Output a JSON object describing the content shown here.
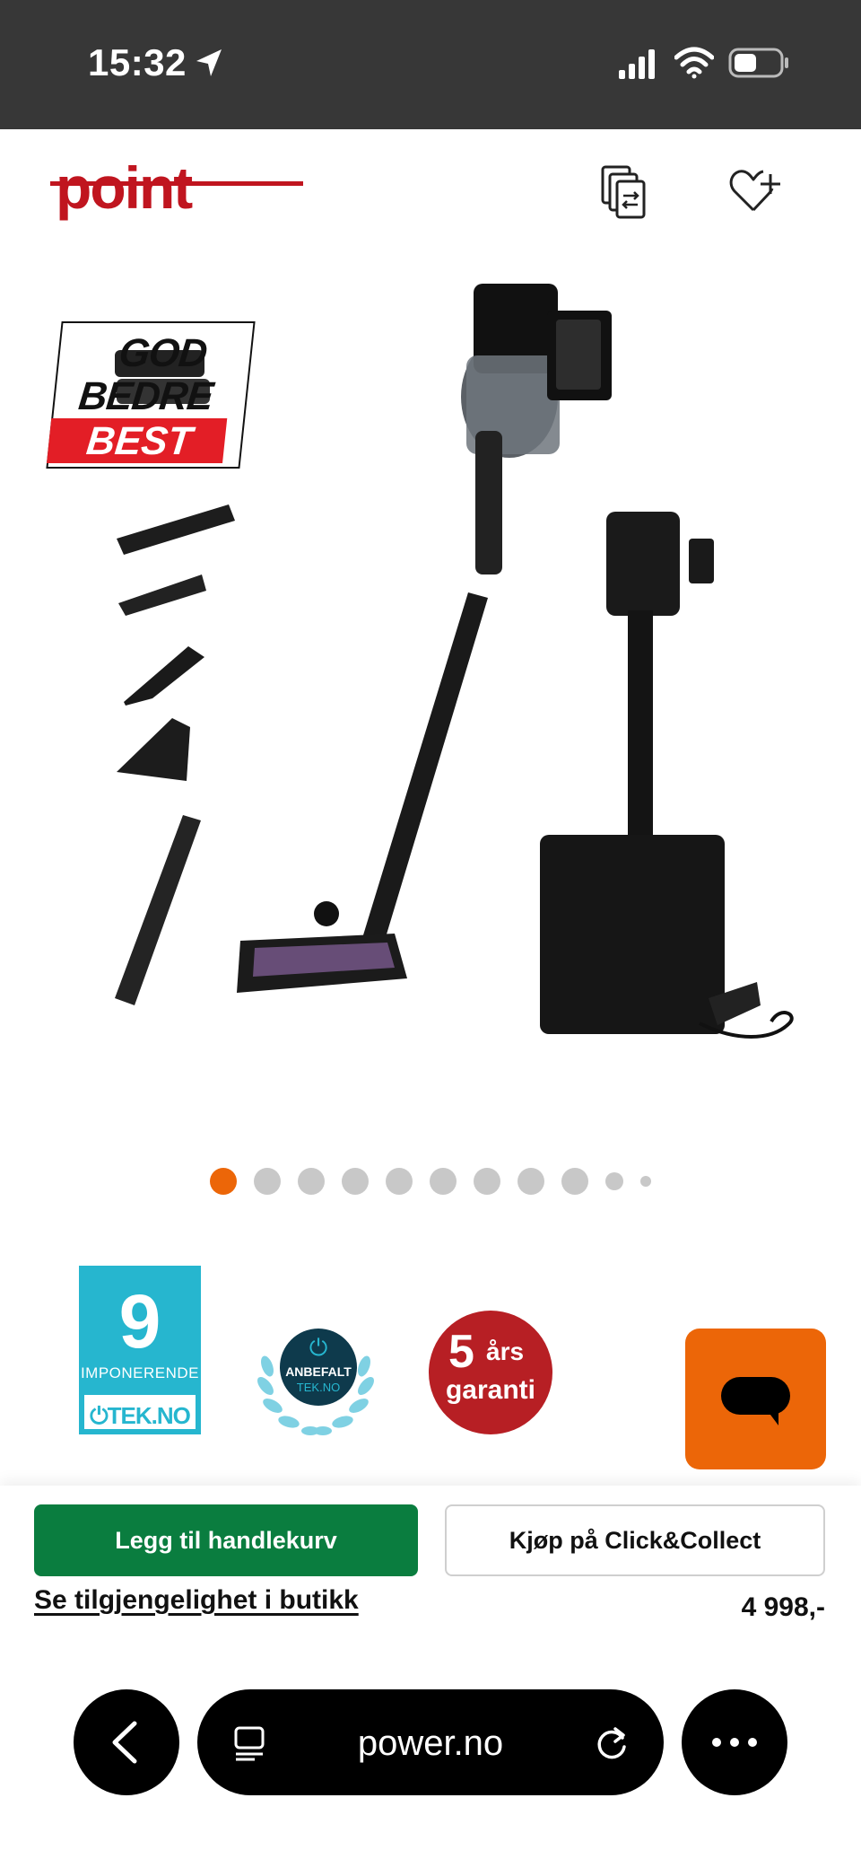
{
  "status_bar": {
    "time": "15:32",
    "icons": [
      "location-arrow-icon",
      "signal-icon",
      "wifi-icon",
      "battery-icon"
    ]
  },
  "header": {
    "logo_text": "point",
    "logo_color": "#c0151f",
    "icons": [
      "compare-icon",
      "wishlist-add-icon"
    ]
  },
  "gallery": {
    "badge": {
      "line1": "GOD",
      "line2": "BEDRE",
      "line3": "BEST"
    },
    "slide_count": 11,
    "active_slide": 1,
    "active_dot_color": "#ec6608",
    "dot_color": "#c8c8c8"
  },
  "awards": {
    "tekno": {
      "score": "9",
      "word": "IMPONERENDE",
      "brand": "TEK.NO"
    },
    "anbefalt": {
      "label": "ANBEFALT",
      "brand": "TEK.NO"
    },
    "garanti": {
      "years": "5",
      "unit": "års",
      "word": "garanti"
    }
  },
  "chat": {
    "icon": "chat-bubble-icon",
    "color": "#ec6608"
  },
  "actions": {
    "add_to_cart": "Legg til handlekurv",
    "click_collect": "Kjøp på Click&Collect",
    "store_availability": "Se tilgjengelighet i butikk",
    "price": "4 998,-"
  },
  "browser": {
    "url": "power.no",
    "icons": [
      "back-chevron-icon",
      "reader-icon",
      "reload-icon",
      "more-icon"
    ]
  }
}
